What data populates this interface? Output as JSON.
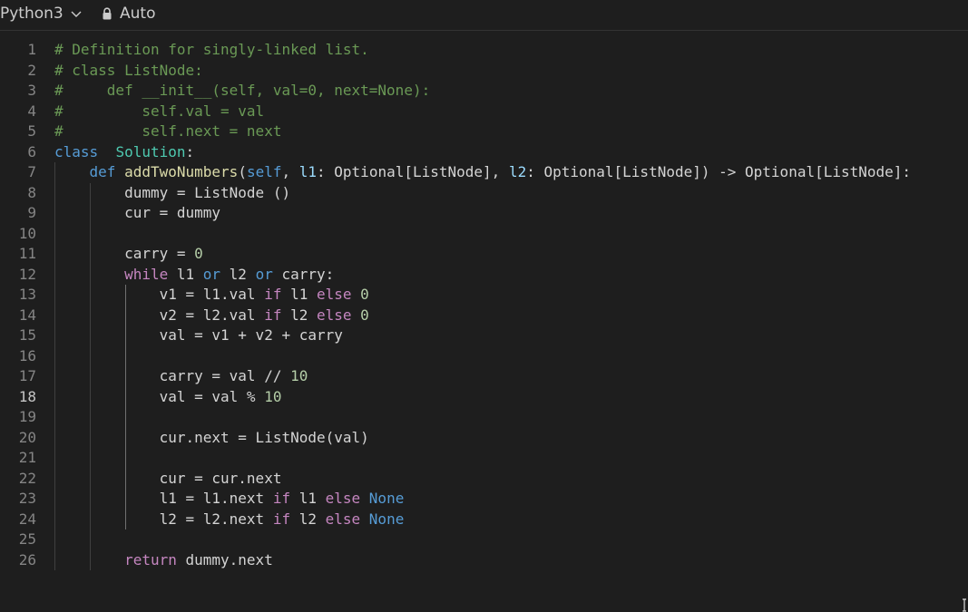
{
  "toolbar": {
    "language": "Python3",
    "mode": "Auto",
    "icons": {
      "chevron": "chevron-down-icon",
      "lock": "lock-icon"
    }
  },
  "editor": {
    "active_line": 18,
    "lines": [
      [
        [
          "cm",
          "# Definition for singly-linked list."
        ]
      ],
      [
        [
          "cm",
          "# class ListNode:"
        ]
      ],
      [
        [
          "cm",
          "#     def __init__(self, val=0, next=None):"
        ]
      ],
      [
        [
          "cm",
          "#         self.val = val"
        ]
      ],
      [
        [
          "cm",
          "#         self.next = next"
        ]
      ],
      [
        [
          "kw",
          "class"
        ],
        [
          "",
          "  "
        ],
        [
          "cls",
          "Solution"
        ],
        [
          "",
          ":"
        ]
      ],
      [
        [
          "",
          "    "
        ],
        [
          "kw",
          "def"
        ],
        [
          "",
          " "
        ],
        [
          "fn",
          "addTwoNumbers"
        ],
        [
          "",
          "("
        ],
        [
          "kw",
          "self"
        ],
        [
          "",
          ", "
        ],
        [
          "prm",
          "l1"
        ],
        [
          "",
          ": Optional[ListNode], "
        ],
        [
          "prm",
          "l2"
        ],
        [
          "",
          ": Optional[ListNode]) -> Optional[ListNode]:"
        ]
      ],
      [
        [
          "",
          "        dummy = ListNode ()"
        ]
      ],
      [
        [
          "",
          "        cur = dummy"
        ]
      ],
      [],
      [
        [
          "",
          "        carry = "
        ],
        [
          "num",
          "0"
        ]
      ],
      [
        [
          "",
          "        "
        ],
        [
          "ctl",
          "while"
        ],
        [
          "",
          " l1 "
        ],
        [
          "kw",
          "or"
        ],
        [
          "",
          " l2 "
        ],
        [
          "kw",
          "or"
        ],
        [
          "",
          " carry:"
        ]
      ],
      [
        [
          "",
          "            v1 = l1.val "
        ],
        [
          "ctl",
          "if"
        ],
        [
          "",
          " l1 "
        ],
        [
          "ctl",
          "else"
        ],
        [
          "",
          " "
        ],
        [
          "num",
          "0"
        ]
      ],
      [
        [
          "",
          "            v2 = l2.val "
        ],
        [
          "ctl",
          "if"
        ],
        [
          "",
          " l2 "
        ],
        [
          "ctl",
          "else"
        ],
        [
          "",
          " "
        ],
        [
          "num",
          "0"
        ]
      ],
      [
        [
          "",
          "            val = v1 + v2 + carry"
        ]
      ],
      [],
      [
        [
          "",
          "            carry = val // "
        ],
        [
          "num",
          "10"
        ]
      ],
      [
        [
          "",
          "            val = val % "
        ],
        [
          "num",
          "10"
        ]
      ],
      [],
      [
        [
          "",
          "            cur.next = ListNode(val)"
        ]
      ],
      [],
      [
        [
          "",
          "            cur = cur.next"
        ]
      ],
      [
        [
          "",
          "            l1 = l1.next "
        ],
        [
          "ctl",
          "if"
        ],
        [
          "",
          " l1 "
        ],
        [
          "ctl",
          "else"
        ],
        [
          "",
          " "
        ],
        [
          "kw",
          "None"
        ]
      ],
      [
        [
          "",
          "            l2 = l2.next "
        ],
        [
          "ctl",
          "if"
        ],
        [
          "",
          " l2 "
        ],
        [
          "ctl",
          "else"
        ],
        [
          "",
          " "
        ],
        [
          "kw",
          "None"
        ]
      ],
      [],
      [
        [
          "",
          "        "
        ],
        [
          "ctl",
          "return"
        ],
        [
          "",
          " dummy.next"
        ]
      ]
    ]
  }
}
